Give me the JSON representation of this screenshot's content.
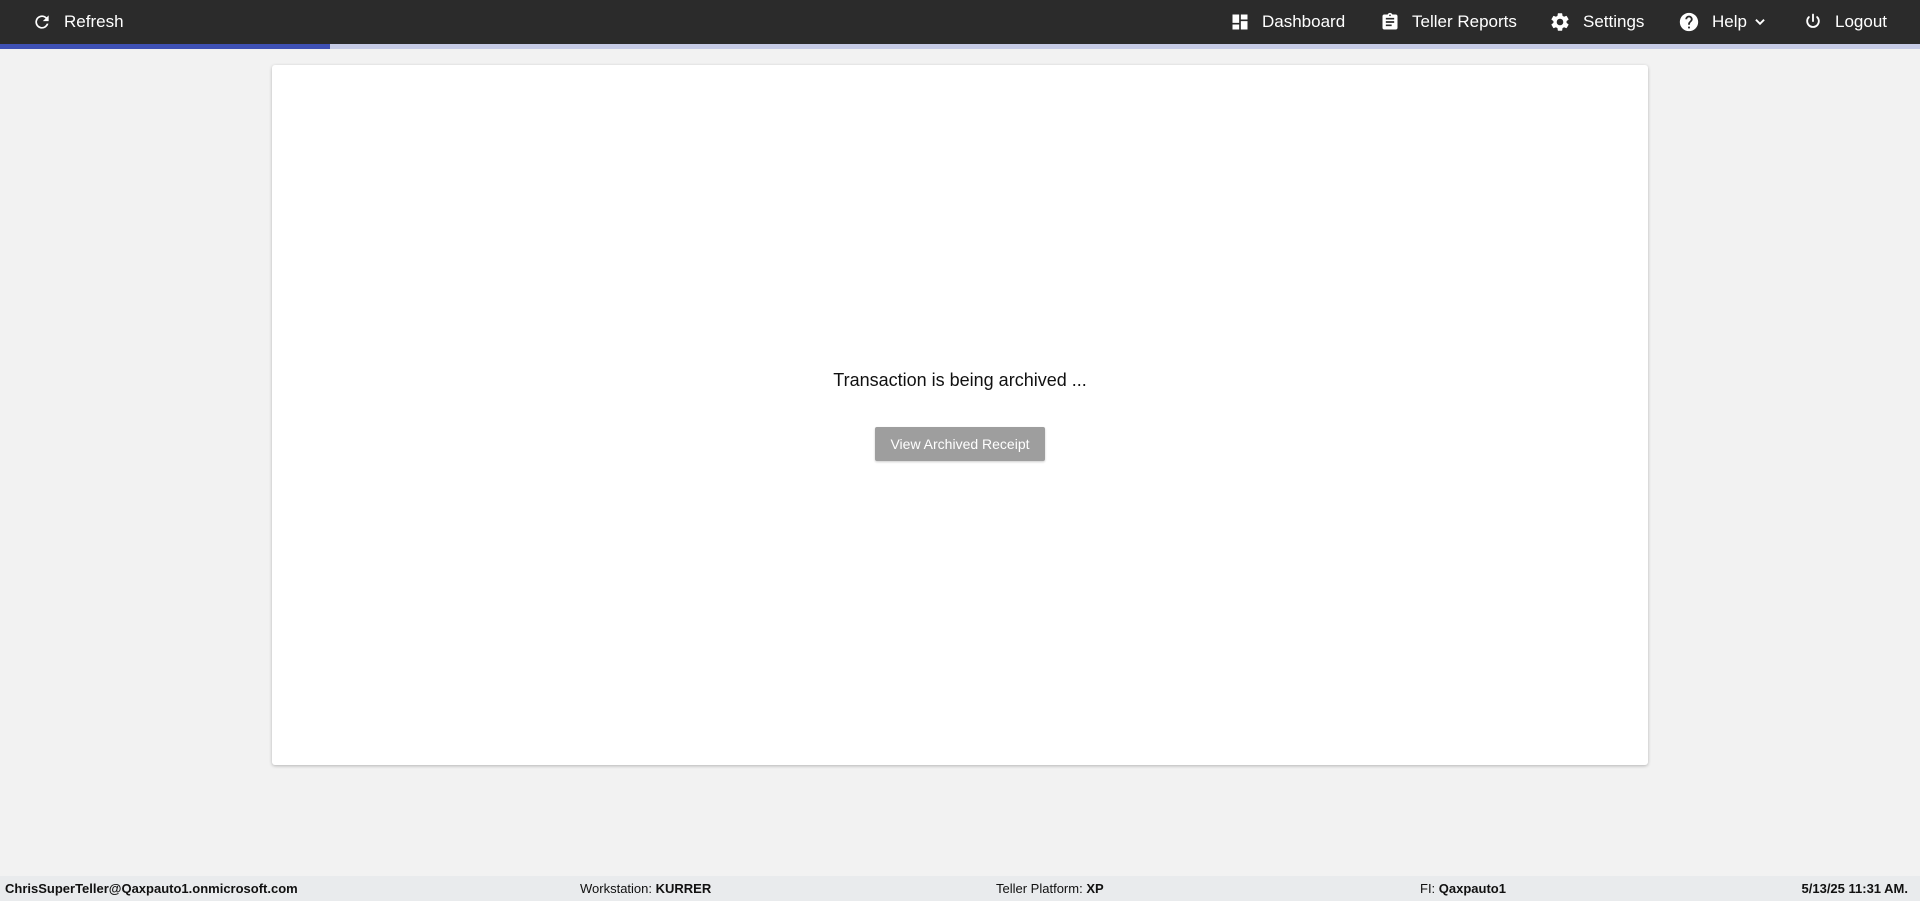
{
  "header": {
    "refresh_label": "Refresh",
    "nav": {
      "dashboard": "Dashboard",
      "teller_reports": "Teller Reports",
      "settings": "Settings",
      "help": "Help",
      "logout": "Logout"
    },
    "progress_fraction": 0.172
  },
  "main": {
    "status_message": "Transaction is being archived ...",
    "view_receipt_label": "View Archived Receipt"
  },
  "footer": {
    "user": "ChrisSuperTeller@Qaxpauto1.onmicrosoft.com",
    "workstation_label": "Workstation: ",
    "workstation_value": "KURRER",
    "platform_label": "Teller Platform: ",
    "platform_value": "XP",
    "fi_label": "FI: ",
    "fi_value": "Qaxpauto1",
    "datetime": "5/13/25 11:31 AM."
  },
  "colors": {
    "topbar": "#2b2b2b",
    "progress": "#3f51b5",
    "button": "#9e9e9e",
    "background": "#f2f2f2"
  }
}
